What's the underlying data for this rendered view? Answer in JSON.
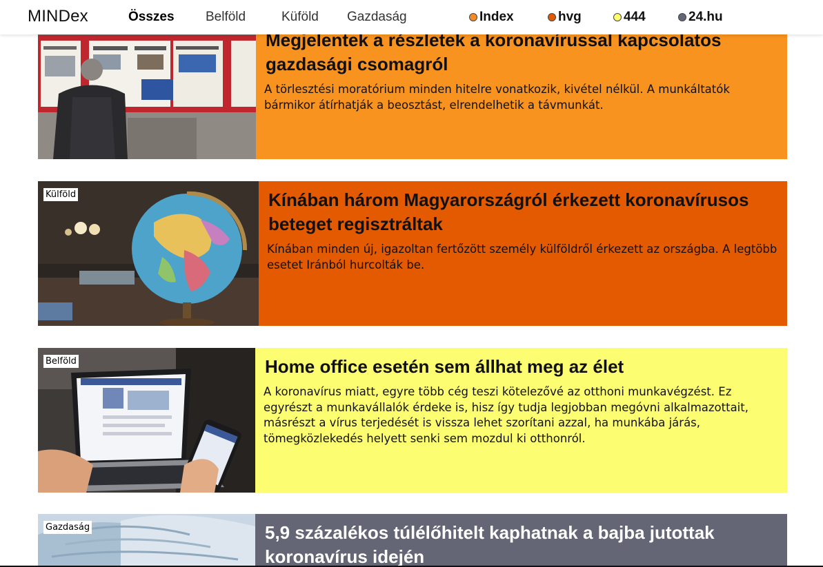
{
  "brand": {
    "name": "MINDex"
  },
  "nav": {
    "categories": [
      "Összes",
      "Belföld",
      "Küföld",
      "Gazdaság"
    ],
    "active": "Összes"
  },
  "sources": [
    {
      "label": "Index",
      "color": "#f28c28"
    },
    {
      "label": "hvg",
      "color": "#e05a00"
    },
    {
      "label": "444",
      "color": "#fdfb6e"
    },
    {
      "label": "24.hu",
      "color": "#646876"
    }
  ],
  "articles": [
    {
      "category": "",
      "title_line1": "Megjelentek a részletek a koronavírussal kapcsolatos",
      "title_line2": "gazdasági csomagról",
      "lead": "A törlesztési moratórium minden hitelre vonatkozik, kivétel nélkül. A munkáltatók bármikor átírhatják a beosztást, elrendelhetik a távmunkát.",
      "background": "#f7931e",
      "text_color": "#111111"
    },
    {
      "category": "Külföld",
      "title_line1": "Kínában három Magyarországról érkezett koronavírusos",
      "title_line2": "beteget regisztráltak",
      "lead": "Kínában minden új, igazoltan fertőzött személy külföldről érkezett az országba. A legtöbb esetet Iránból hurcolták be.",
      "background": "#e35a00",
      "text_color": "#111111"
    },
    {
      "category": "Belföld",
      "title_line1": "Home office esetén sem állhat meg az élet",
      "title_line2": "",
      "lead": "A koronavírus miatt, egyre több cég teszi kötelezővé az otthoni munkavégzést. Ez egyrészt a munkavállalók érdeke is, hisz így tudja legjobban megóvni alkalmazottait, másrészt a vírus terjedését is vissza lehet szorítani azzal, ha munkába járás, tömegközlekedés helyett senki sem mozdul ki otthonról.",
      "background": "#fdfd72",
      "text_color": "#111111"
    },
    {
      "category": "Gazdaság",
      "title_line1": "5,9 százalékos túlélőhitelt kaphatnak a bajba jutottak",
      "title_line2": "koronavírus idején",
      "lead": "",
      "background": "#646575",
      "text_color": "#ffffff"
    }
  ]
}
